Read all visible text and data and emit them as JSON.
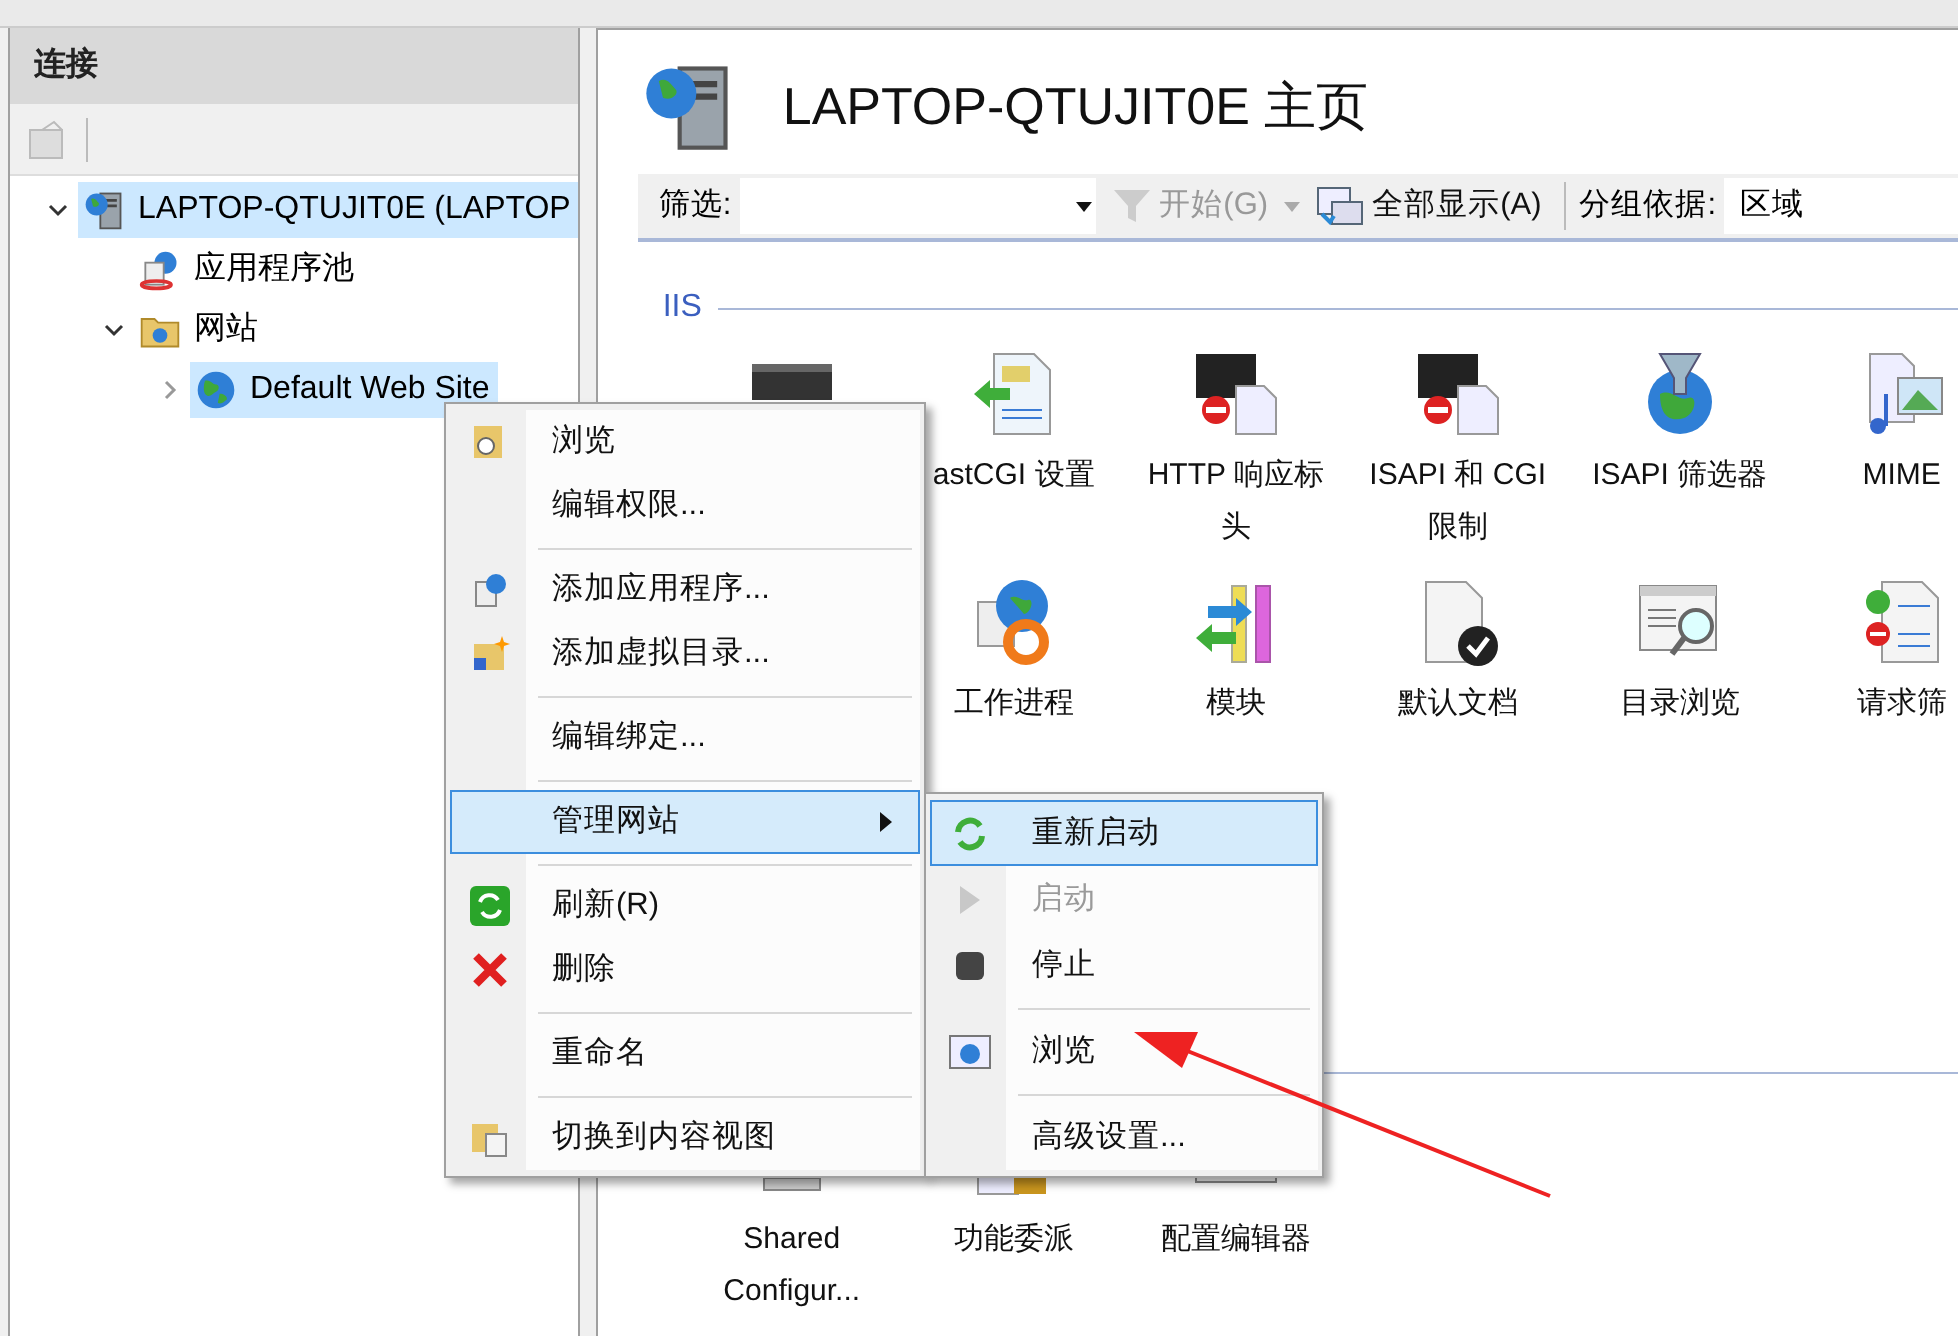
{
  "connections": {
    "title": "连接",
    "tree": [
      {
        "label": "LAPTOP-QTUJIT0E (LAPTOP",
        "selected": true,
        "expanded": true,
        "children": [
          {
            "label": "应用程序池",
            "selected": false
          },
          {
            "label": "网站",
            "selected": false,
            "expanded": true,
            "children": [
              {
                "label": "Default Web Site",
                "selected": true,
                "expanded": false
              }
            ]
          }
        ]
      }
    ]
  },
  "main": {
    "title": "LAPTOP-QTUJIT0E 主页",
    "filter": {
      "label": "筛选:",
      "start": "开始(G)",
      "start_disabled": true,
      "show_all": "全部显示(A)",
      "group_label": "分组依据:",
      "group_value": "区域"
    },
    "groups": [
      {
        "title": "IIS",
        "rows": [
          [
            {
              "kind": "covered"
            },
            {
              "kind": "feature",
              "label": "astCGI 设置"
            },
            {
              "kind": "feature",
              "label": "HTTP 响应标头"
            },
            {
              "kind": "feature",
              "label": "ISAPI 和 CGI 限制"
            },
            {
              "kind": "feature",
              "label": "ISAPI 筛选器"
            },
            {
              "kind": "feature",
              "label": "MIME"
            }
          ],
          [
            {
              "kind": "covered"
            },
            {
              "kind": "feature",
              "label": "工作进程"
            },
            {
              "kind": "feature",
              "label": "模块"
            },
            {
              "kind": "feature",
              "label": "默认文档"
            },
            {
              "kind": "feature",
              "label": "目录浏览"
            },
            {
              "kind": "feature",
              "label": "请求筛"
            }
          ]
        ]
      },
      {
        "rows": [
          [
            {
              "kind": "feature",
              "label": "Shared Configur..."
            },
            {
              "kind": "feature",
              "label": "功能委派"
            },
            {
              "kind": "feature",
              "label": "配置编辑器"
            }
          ]
        ]
      }
    ]
  },
  "context_menu": {
    "items": [
      {
        "kind": "item",
        "label": "浏览",
        "selected": false
      },
      {
        "kind": "item",
        "label": "编辑权限...",
        "selected": false
      },
      {
        "kind": "separator"
      },
      {
        "kind": "item",
        "label": "添加应用程序...",
        "selected": false
      },
      {
        "kind": "item",
        "label": "添加虚拟目录...",
        "selected": false
      },
      {
        "kind": "separator"
      },
      {
        "kind": "item",
        "label": "编辑绑定...",
        "selected": false
      },
      {
        "kind": "separator"
      },
      {
        "kind": "submenu",
        "label": "管理网站",
        "selected": true
      },
      {
        "kind": "separator"
      },
      {
        "kind": "item",
        "label": "刷新(R)",
        "selected": false
      },
      {
        "kind": "item",
        "label": "删除",
        "selected": false
      },
      {
        "kind": "separator"
      },
      {
        "kind": "item",
        "label": "重命名",
        "selected": false
      },
      {
        "kind": "separator"
      },
      {
        "kind": "item",
        "label": "切换到内容视图",
        "selected": false
      }
    ]
  },
  "submenu": {
    "items": [
      {
        "kind": "item",
        "label": "重新启动",
        "selected": true,
        "disabled": false
      },
      {
        "kind": "item",
        "label": "启动",
        "selected": false,
        "disabled": true
      },
      {
        "kind": "item",
        "label": "停止",
        "selected": false,
        "disabled": false
      },
      {
        "kind": "separator"
      },
      {
        "kind": "item",
        "label": "浏览",
        "selected": false,
        "disabled": false
      },
      {
        "kind": "separator"
      },
      {
        "kind": "item",
        "label": "高级设置...",
        "selected": false,
        "disabled": false
      }
    ]
  }
}
